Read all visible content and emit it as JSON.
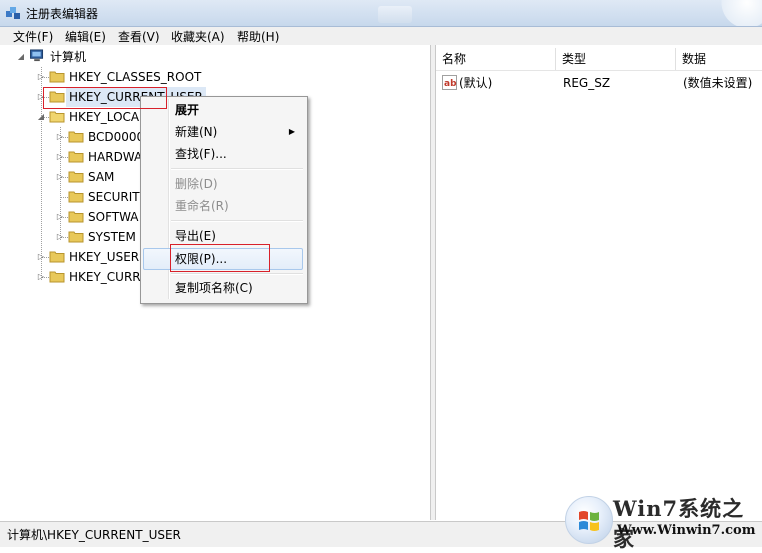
{
  "window": {
    "title": "注册表编辑器",
    "icon": "regedit-icon"
  },
  "menu": [
    "文件(F)",
    "编辑(E)",
    "查看(V)",
    "收藏夹(A)",
    "帮助(H)"
  ],
  "tree": {
    "root": "计算机",
    "items": [
      "HKEY_CLASSES_ROOT",
      "HKEY_CURRENT_USER",
      "HKEY_LOCAL",
      "BCD0000",
      "HARDWA",
      "SAM",
      "SECURIT",
      "SOFTWA",
      "SYSTEM",
      "HKEY_USERS",
      "HKEY_CURR"
    ]
  },
  "list": {
    "columns": [
      "名称",
      "类型",
      "数据"
    ],
    "rows": [
      {
        "name": "(默认)",
        "type": "REG_SZ",
        "data": "(数值未设置)"
      }
    ]
  },
  "context_menu": [
    {
      "label": "展开",
      "bold": true
    },
    {
      "label": "新建(N)",
      "submenu": true
    },
    {
      "label": "查找(F)..."
    },
    {
      "label": "删除(D)",
      "disabled": true
    },
    {
      "label": "重命名(R)",
      "disabled": true
    },
    {
      "label": "导出(E)"
    },
    {
      "label": "权限(P)...",
      "highlighted": true
    },
    {
      "label": "复制项名称(C)"
    }
  ],
  "status": {
    "path": "计算机\\HKEY_CURRENT_USER"
  },
  "watermark": {
    "title": "Win7系统之家",
    "url": "Www.Winwin7.com"
  },
  "colors": {
    "highlight_box": "#d8212a",
    "folder": "#e8c85a"
  }
}
